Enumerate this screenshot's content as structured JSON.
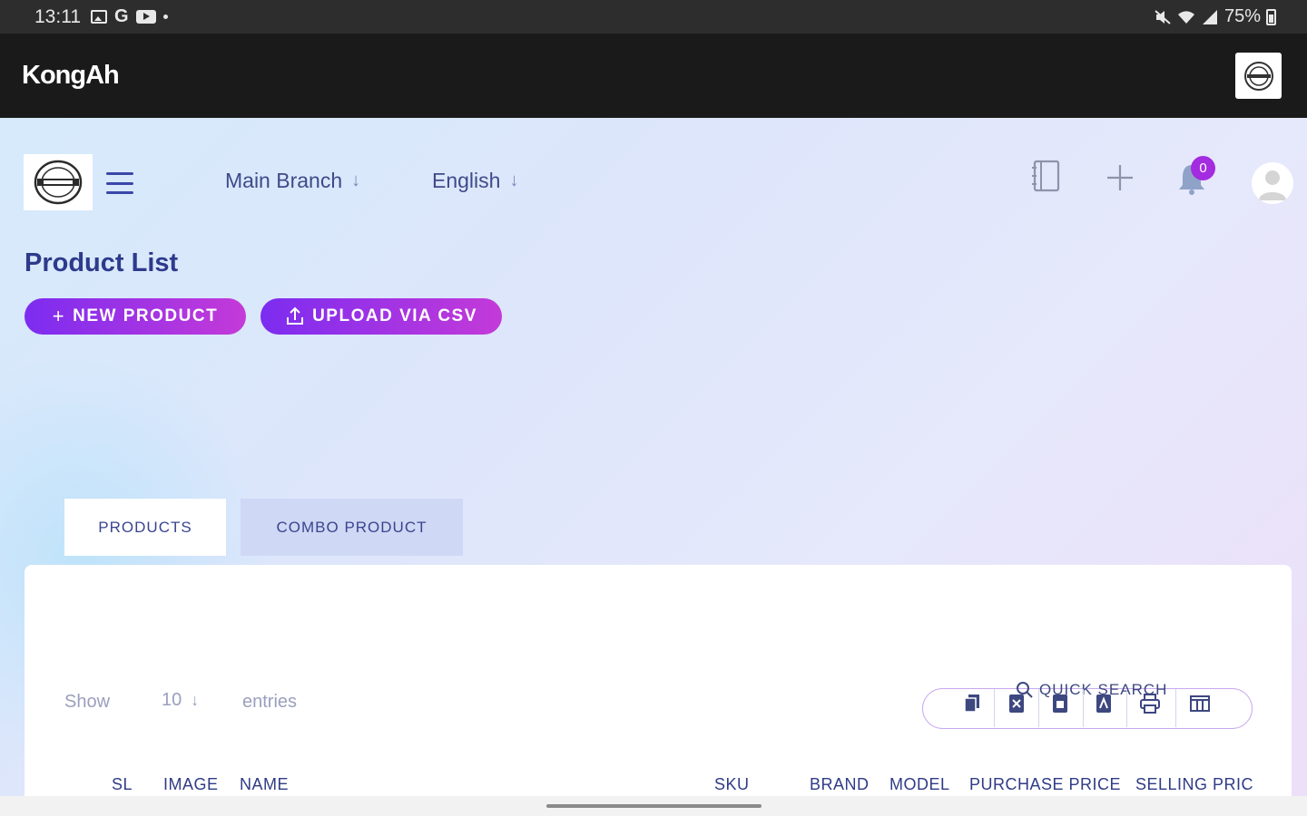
{
  "status_bar": {
    "time": "13:11",
    "battery": "75%",
    "left_icons": [
      "image-icon",
      "google-icon",
      "youtube-icon",
      "dot-icon"
    ],
    "right_icons": [
      "mute-icon",
      "wifi-icon",
      "signal-icon",
      "battery-icon"
    ]
  },
  "app_bar": {
    "title": "KongAh",
    "logo": "kong-ah-logo"
  },
  "header": {
    "branch_selector": "Main Branch",
    "language_selector": "English",
    "icons": [
      "notebook-icon",
      "plus-icon",
      "bell-icon",
      "avatar-icon"
    ],
    "notification_count": "0"
  },
  "page": {
    "title": "Product List",
    "new_product_label": "NEW PRODUCT",
    "upload_csv_label": "UPLOAD VIA CSV"
  },
  "tabs": [
    {
      "label": "PRODUCTS",
      "active": true
    },
    {
      "label": "COMBO PRODUCT",
      "active": false
    }
  ],
  "table": {
    "show_label": "Show",
    "page_size": "10",
    "entries_label": "entries",
    "search_placeholder": "QUICK SEARCH",
    "tools": [
      "copy-icon",
      "excel-icon",
      "csv-icon",
      "pdf-icon",
      "print-icon",
      "columns-icon"
    ],
    "columns": [
      "SL",
      "IMAGE",
      "NAME",
      "SKU",
      "BRAND",
      "MODEL",
      "PURCHASE PRICE",
      "SELLING PRICE"
    ]
  },
  "colors": {
    "accent_start": "#7c2cf0",
    "accent_end": "#c43ad8",
    "primary_text": "#2d3a8c",
    "app_bar": "#1a1a1a",
    "badge": "#a32be0"
  }
}
